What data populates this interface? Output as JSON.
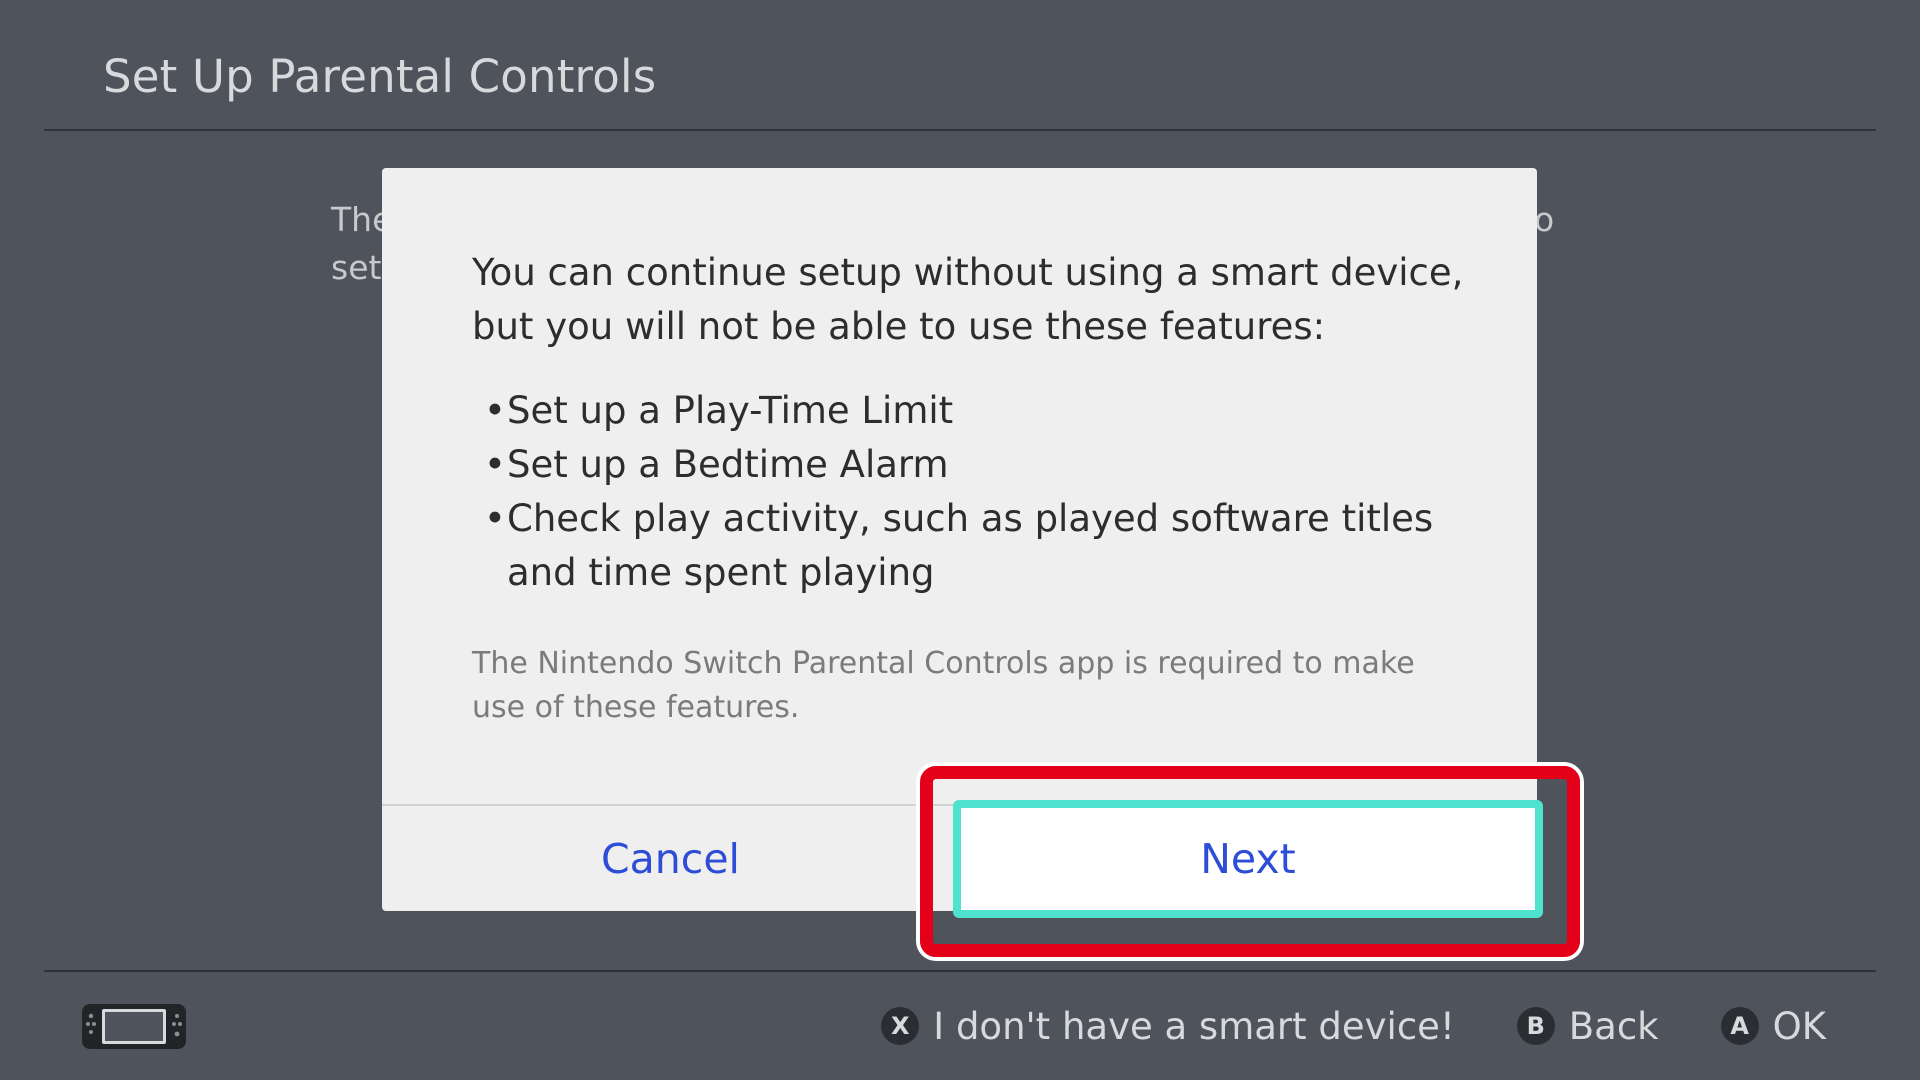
{
  "header": {
    "title": "Set Up Parental Controls"
  },
  "background": {
    "text_line1_fragment": "The",
    "text_line2_fragment": "set",
    "text_right_fragment": "o"
  },
  "dialog": {
    "lead": "You can continue setup without using a smart device, but you will not be able to use these features:",
    "features": [
      "Set up a Play-Time Limit",
      "Set up a Bedtime Alarm",
      "Check play activity, such as played software titles and time spent playing"
    ],
    "bullet": "•",
    "note": "The Nintendo Switch Parental Controls app is required to make use of these features.",
    "cancel_label": "Cancel",
    "next_label": "Next"
  },
  "footer": {
    "console_icon": "console-icon",
    "actions": [
      {
        "button": "X",
        "label": "I don't have a smart device!"
      },
      {
        "button": "B",
        "label": "Back"
      },
      {
        "button": "A",
        "label": "OK"
      }
    ]
  },
  "colors": {
    "background": "#4f535b",
    "dialog": "#efefef",
    "link_blue": "#2d4dd6",
    "focus_cyan": "#4fe3cf",
    "highlight_red": "#e50019"
  }
}
